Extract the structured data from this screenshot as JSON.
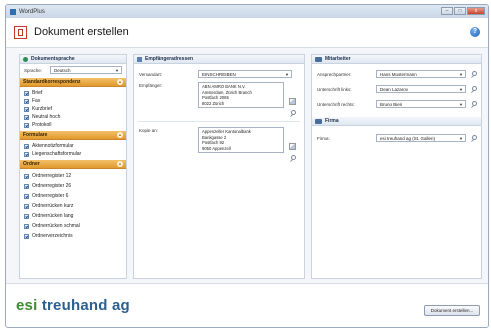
{
  "window": {
    "title": "WordPlus",
    "minimize": "–",
    "maximize": "□",
    "close": "x"
  },
  "header": {
    "title": "Dokument erstellen",
    "help": "?"
  },
  "left": {
    "sprache": {
      "title": "Dokumentsprache",
      "label": "Sprache:",
      "value": "Deutsch"
    },
    "standard": {
      "title": "Standardkorrespondenz",
      "items": [
        "Brief",
        "Fax",
        "Kurzbrief",
        "Neutral hoch",
        "Protokoll"
      ]
    },
    "formulare": {
      "title": "Formulare",
      "items": [
        "Aktennotizformular",
        "Liegenschaftsformular"
      ]
    },
    "ordner": {
      "title": "Ordner",
      "items": [
        "Ordnerregister 12",
        "Ordnerregister 26",
        "Ordnerregister 6",
        "Ordnerrücken kurz",
        "Ordnerrücken lang",
        "Ordnerrücken schmal",
        "Ordnerverzeichnis"
      ]
    }
  },
  "middle": {
    "title": "Empfängeradressen",
    "versandart_label": "Versandart:",
    "versandart_value": "EINSCHREIBEN",
    "empfaenger_label": "Empfänger:",
    "empfaenger_lines": [
      "ABN AMRO BANK N.V.",
      "Amsterdam, Zürich Branch",
      "Postfach 2065",
      "8022 Zürich"
    ],
    "kopie_label": "Kopie an:",
    "kopie_lines": [
      "Appenzeller Kantonalbank",
      "Bankgasse 2",
      "Postfach 92",
      "9050 Appenzell"
    ]
  },
  "right": {
    "mitarbeiter_title": "Mitarbeiter",
    "ansprech_label": "Ansprechpartner:",
    "ansprech_value": "Hans Mustermann",
    "links_label": "Unterschrift links:",
    "links_value": "Dean Lazarov",
    "rechts_label": "Unterschrift rechts:",
    "rechts_value": "Bruno Bieri",
    "firma_title": "Firma",
    "firma_label": "Firma:",
    "firma_value": "esi treuhand ag (St. Gallen)"
  },
  "footer": {
    "brand_left": "esi",
    "brand_right": "treuhand ag",
    "button": "Dokument erstellen..."
  }
}
